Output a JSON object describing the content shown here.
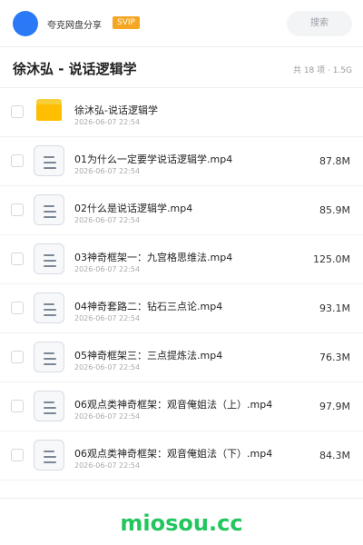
{
  "header": {
    "user_name": "夸克网盘分享",
    "badge": "SVIP",
    "search_placeholder": "搜索"
  },
  "folder": {
    "title": "徐沐弘 - 说话逻辑学",
    "meta": "共 18 项 · 1.5G"
  },
  "items": [
    {
      "type": "folder",
      "name": "徐沐弘-说话逻辑学",
      "date": "2026-06-07 22:54",
      "size": ""
    },
    {
      "type": "file",
      "name": "01为什么一定要学说话逻辑学.mp4",
      "date": "2026-06-07 22:54",
      "size": "87.8M"
    },
    {
      "type": "file",
      "name": "02什么是说话逻辑学.mp4",
      "date": "2026-06-07 22:54",
      "size": "85.9M"
    },
    {
      "type": "file",
      "name": "03神奇框架一：九宫格思维法.mp4",
      "date": "2026-06-07 22:54",
      "size": "125.0M"
    },
    {
      "type": "file",
      "name": "04神奇套路二：钻石三点论.mp4",
      "date": "2026-06-07 22:54",
      "size": "93.1M"
    },
    {
      "type": "file",
      "name": "05神奇框架三：三点提炼法.mp4",
      "date": "2026-06-07 22:54",
      "size": "76.3M"
    },
    {
      "type": "file",
      "name": "06观点类神奇框架：观音俺姐法（上）.mp4",
      "date": "2026-06-07 22:54",
      "size": "97.9M"
    },
    {
      "type": "file",
      "name": "06观点类神奇框架：观音俺姐法（下）.mp4",
      "date": "2026-06-07 22:54",
      "size": "84.3M"
    }
  ],
  "watermark": "miosou.cc",
  "colors": {
    "avatar": "#2a79f6",
    "badge": "#f5a623",
    "folder": "#ffbf00",
    "watermark": "#22c55e"
  }
}
